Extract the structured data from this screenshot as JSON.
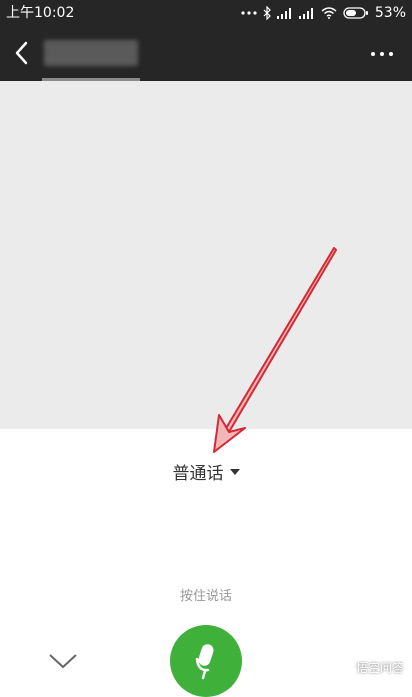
{
  "status_bar": {
    "time": "上午10:02",
    "battery": "53%"
  },
  "nav": {
    "icons": [
      "back-icon",
      "more-icon"
    ]
  },
  "voice": {
    "language": "普通话",
    "hint": "按住说话",
    "icons": [
      "dropdown-icon",
      "collapse-icon",
      "microphone-icon"
    ]
  },
  "watermark": {
    "text": "悟空问答"
  },
  "annotation": {
    "arrow_color": "#d42a34"
  },
  "colors": {
    "nav_bg": "#262626",
    "content_bg": "#ebebeb",
    "mic_green": "#3fb13a"
  }
}
